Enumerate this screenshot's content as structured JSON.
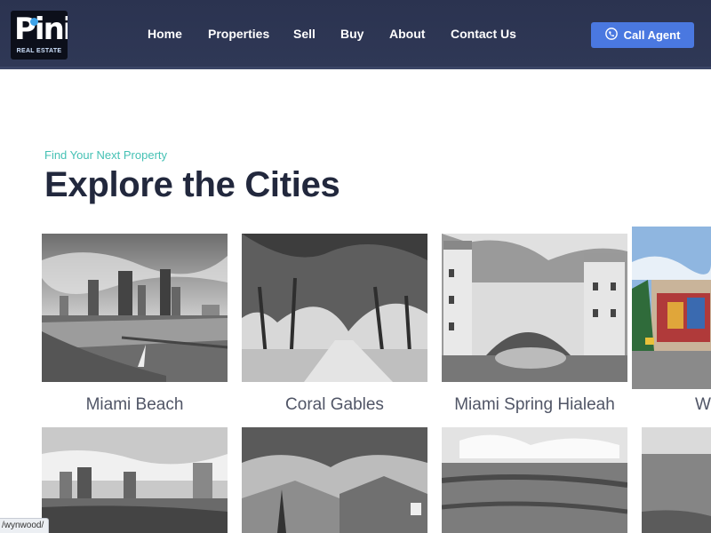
{
  "brand": {
    "logo_text": "Pini",
    "logo_sub": "REAL ESTATE"
  },
  "nav": [
    "Home",
    "Properties",
    "Sell",
    "Buy",
    "About",
    "Contact Us"
  ],
  "call_button": {
    "label": "Call Agent",
    "icon": "phone-icon"
  },
  "section": {
    "eyebrow": "Find Your Next Property",
    "title": "Explore the Cities"
  },
  "cities": [
    {
      "label": "Miami Beach"
    },
    {
      "label": "Coral Gables"
    },
    {
      "label": "Miami Spring Hialeah"
    },
    {
      "label": "W"
    }
  ],
  "status_url": "/wynwood/",
  "colors": {
    "header": "#2f3856",
    "accent": "#4a78e0",
    "eyebrow": "#45c1b4",
    "title": "#22283d"
  }
}
